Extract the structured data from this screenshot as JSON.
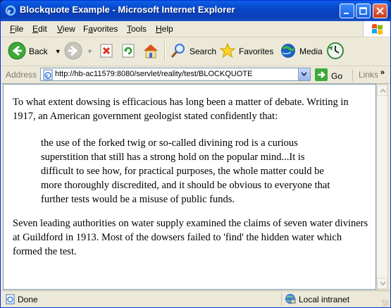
{
  "window": {
    "title": "Blockquote Example - Microsoft Internet Explorer"
  },
  "menu": {
    "items": [
      {
        "label": "File",
        "key": "F",
        "rest": "ile"
      },
      {
        "label": "Edit",
        "key": "E",
        "rest": "dit"
      },
      {
        "label": "View",
        "key": "V",
        "rest": "iew"
      },
      {
        "label": "Favorites",
        "key": "a",
        "pre": "F",
        "rest": "vorites"
      },
      {
        "label": "Tools",
        "key": "T",
        "rest": "ools"
      },
      {
        "label": "Help",
        "key": "H",
        "rest": "elp"
      }
    ]
  },
  "toolbar": {
    "back_label": "Back",
    "search_label": "Search",
    "favorites_label": "Favorites",
    "media_label": "Media"
  },
  "address": {
    "label": "Address",
    "url": "http://hb-ac11579:8080/servlet/reality/test/BLOCKQUOTE",
    "go_label": "Go",
    "links_label": "Links",
    "chevron": "»"
  },
  "content": {
    "paragraph1": "To what extent dowsing is efficacious has long been a matter of debate. Writing in 1917, an American government geologist stated confidently that:",
    "blockquote": "the use of the forked twig or so-called divining rod is a curious superstition that still has a strong hold on the popular mind...It is difficult to see how, for practical purposes, the whole matter could be more thoroughly discredited, and it should be obvious to everyone that further tests would be a misuse of public funds.",
    "paragraph2": "Seven leading authorities on water supply examined the claims of seven water diviners at Guildford in 1913. Most of the dowsers failed to 'find' the hidden water which formed the test."
  },
  "status": {
    "text": "Done",
    "zone": "Local intranet"
  }
}
